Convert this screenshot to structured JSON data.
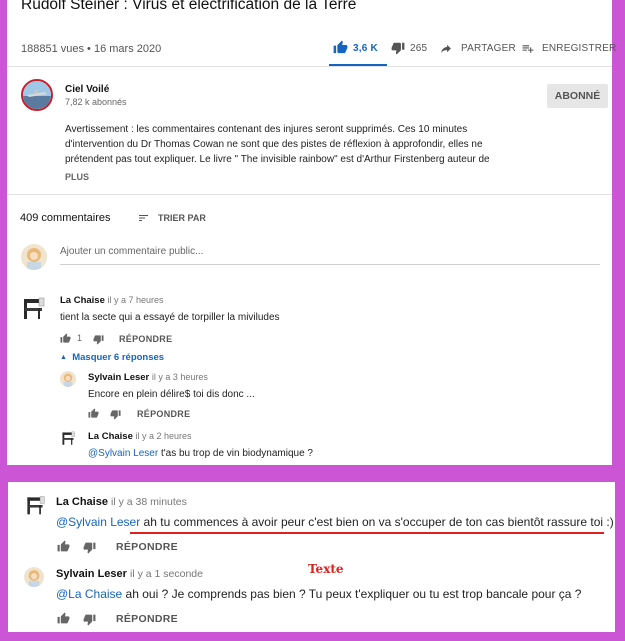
{
  "video": {
    "title": "Rudolf Steiner : Virus et électrification de la Terre",
    "meta": "188851 vues • 16 mars 2020",
    "like_count": "3,6 K",
    "dislike_count": "265",
    "share_label": "PARTAGER",
    "save_label": "ENREGISTRER"
  },
  "channel": {
    "name": "Ciel Voilé",
    "subscribers": "7,82 k abonnés",
    "subscribe_label": "ABONNÉ"
  },
  "description": {
    "lines": [
      "Avertissement : les commentaires contenant des injures seront supprimés. Ces 10 minutes",
      "d'intervention du Dr Thomas Cowan ne sont que des pistes de réflexion à approfondir, elles ne",
      "prétendent pas tout expliquer. Le livre \" The invisible rainbow\" est d'Arthur Firstenberg auteur de"
    ],
    "more_label": "PLUS"
  },
  "comments_header": {
    "count": "409 commentaires",
    "sort_label": "TRIER PAR"
  },
  "add_comment": {
    "placeholder": "Ajouter un commentaire public..."
  },
  "comment1": {
    "author": "La Chaise",
    "time": "il y a 7 heures",
    "text": "tient la secte qui a essayé de torpiller la miviludes",
    "likes": "1",
    "reply_label": "RÉPONDRE",
    "hide_replies_label": "Masquer 6 réponses"
  },
  "reply1": {
    "author": "Sylvain Leser",
    "time": "il y a 3 heures",
    "text": "Encore en plein délire$ toi dis donc ...",
    "reply_label": "RÉPONDRE"
  },
  "reply2": {
    "author": "La Chaise",
    "time": "il y a 2 heures",
    "mention": "@Sylvain Leser",
    "text": " t'as bu trop de vin biodynamique ?"
  },
  "reply3": {
    "author": "La Chaise",
    "time": "il y a 38 minutes",
    "mention": "@Sylvain Leser",
    "text": " ah tu commences à avoir peur c'est bien on va s'occuper de ton cas bientôt rassure toi  :)",
    "reply_label": "RÉPONDRE"
  },
  "reply4": {
    "author": "Sylvain Leser",
    "time": "il y a 1 seconde",
    "mention": "@La Chaise",
    "text": " ah oui ? Je comprends pas bien ? Tu peux t'expliquer ou tu est trop bancale pour ça ?",
    "reply_label": "RÉPONDRE"
  },
  "annotation": {
    "label": "Texte"
  },
  "colors": {
    "frame": "#cc55d6",
    "link": "#1565c0",
    "underline": "#e02020",
    "like_active": "#1565c0"
  }
}
